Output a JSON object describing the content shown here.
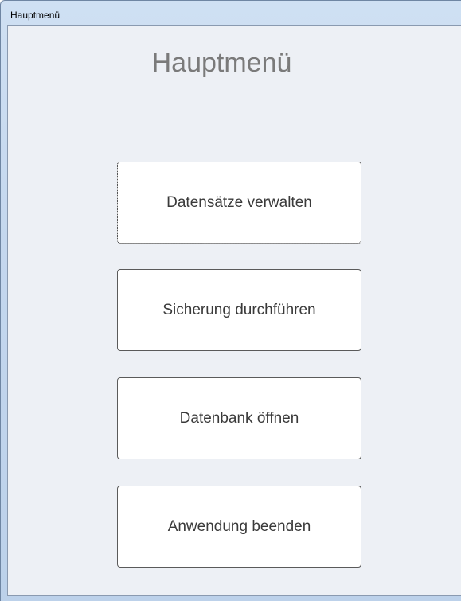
{
  "window": {
    "title": "Hauptmenü"
  },
  "form": {
    "heading": "Hauptmenü",
    "buttons": [
      {
        "label": "Datensätze verwalten",
        "focused": true
      },
      {
        "label": "Sicherung durchführen",
        "focused": false
      },
      {
        "label": "Datenbank öffnen",
        "focused": false
      },
      {
        "label": "Anwendung beenden",
        "focused": false
      }
    ]
  },
  "colors": {
    "frame": "#c4d7ee",
    "client_background": "#edf0f5",
    "heading_text": "#7a7a7a",
    "button_background": "#ffffff",
    "button_text": "#3a3a3a"
  }
}
